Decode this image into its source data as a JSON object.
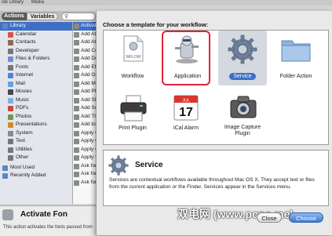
{
  "topbar": {
    "items": [
      "ide Library",
      "Media"
    ]
  },
  "library_tabs": {
    "actions": "Actions",
    "variables": "Variables"
  },
  "library": {
    "items": [
      {
        "label": "Library",
        "color": "#5b86c7"
      },
      {
        "label": "Calendar",
        "color": "#d9534f"
      },
      {
        "label": "Contacts",
        "color": "#8b6d4b"
      },
      {
        "label": "Developer",
        "color": "#777777"
      },
      {
        "label": "Files & Folders",
        "color": "#6b8fd4"
      },
      {
        "label": "Fonts",
        "color": "#777777"
      },
      {
        "label": "Internet",
        "color": "#4c88d8"
      },
      {
        "label": "Mail",
        "color": "#6aa0d8"
      },
      {
        "label": "Movies",
        "color": "#4a4a4a"
      },
      {
        "label": "Music",
        "color": "#7fb0e0"
      },
      {
        "label": "PDFs",
        "color": "#c94a3a"
      },
      {
        "label": "Photos",
        "color": "#6b9a4a"
      },
      {
        "label": "Presentations",
        "color": "#d68a2a"
      },
      {
        "label": "System",
        "color": "#8a8a8a"
      },
      {
        "label": "Text",
        "color": "#777777"
      },
      {
        "label": "Utilities",
        "color": "#777777"
      },
      {
        "label": "Other",
        "color": "#777777"
      },
      {
        "label": "Most Used",
        "color": "#5b86c7"
      },
      {
        "label": "Recently Added",
        "color": "#5b86c7"
      }
    ]
  },
  "actions": {
    "items": [
      "Activate",
      "Add Atta",
      "Add Atta",
      "Add Color",
      "Add Docu",
      "Add Effe",
      "Add Grid",
      "Add Mov",
      "Add Pho",
      "Add Slide",
      "Add Song",
      "Add Thu",
      "Add to F",
      "Apply Co",
      "Apply Qu",
      "Apply Q",
      "Apply SC",
      "Ask for F",
      "Ask for I",
      "Ask for T"
    ]
  },
  "selected_action": {
    "title": "Activate Fon",
    "description": "This action activates the fonts passed from"
  },
  "dialog": {
    "heading": "Choose a template for your workflow:",
    "templates": [
      {
        "label": "Workflow",
        "icon": "wflow-document-icon",
        "doc_text": "WFLOW"
      },
      {
        "label": "Application",
        "icon": "automator-robot-icon"
      },
      {
        "label": "Service",
        "icon": "gear-icon"
      },
      {
        "label": "Folder Action",
        "icon": "folder-icon"
      },
      {
        "label": "Print Plugin",
        "icon": "printer-icon"
      },
      {
        "label": "iCal Alarm",
        "icon": "calendar-icon",
        "cal_month": "JUL",
        "cal_day": "17"
      },
      {
        "label": "Image Capture Plugin",
        "icon": "camera-icon"
      }
    ],
    "info": {
      "title": "Service",
      "text": "Services are contextual workflows available throughout Mac OS X. They accept text or files from the current application or the Finder. Services appear in the Services menu."
    },
    "buttons": {
      "close": "Close",
      "choose": "Choose"
    }
  },
  "watermark": "双电网 (www.pcpc.me)",
  "colors": {
    "accent": "#3d6fc5",
    "highlight_border": "#e0223a"
  }
}
